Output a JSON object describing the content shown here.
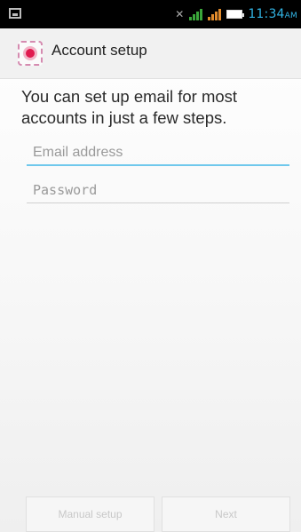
{
  "status_bar": {
    "time": "11:34",
    "ampm": "AM",
    "icons": [
      "image-icon",
      "mute-icon",
      "signal-icon",
      "signal-icon",
      "battery-icon"
    ]
  },
  "app_bar": {
    "title": "Account setup",
    "icon": "email-app-icon"
  },
  "main": {
    "intro": "You can set up email for most accounts in just a few steps.",
    "email_placeholder": "Email address",
    "password_placeholder": "Password"
  },
  "buttons": {
    "manual_setup": "Manual setup",
    "next": "Next"
  },
  "colors": {
    "status_bar_bg": "#000000",
    "accent": "#32b5e5",
    "app_icon_accent": "#e01a4f"
  }
}
